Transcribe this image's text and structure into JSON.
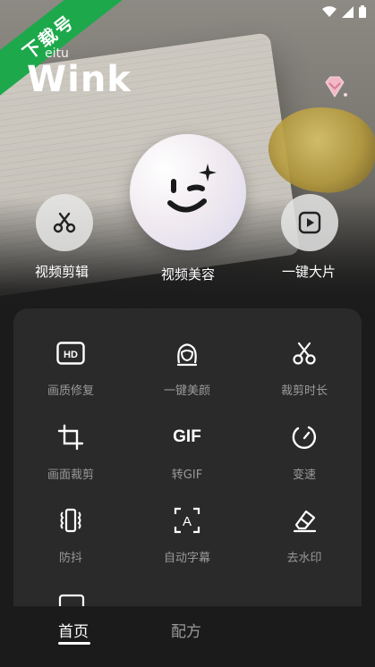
{
  "ribbon": {
    "text": "下载号"
  },
  "brand": {
    "small": "eitu",
    "name": "Wink"
  },
  "status_icons": [
    "wifi-icon",
    "signal-icon",
    "battery-icon"
  ],
  "premium": {
    "icon": "diamond-icon"
  },
  "features": [
    {
      "label": "视频剪辑",
      "icon": "scissors-icon"
    },
    {
      "label": "视频美容",
      "icon": "wink-face-icon"
    },
    {
      "label": "一键大片",
      "icon": "play-icon"
    }
  ],
  "tools": [
    {
      "label": "画质修复",
      "icon": "hd-icon"
    },
    {
      "label": "一键美颜",
      "icon": "face-beauty-icon"
    },
    {
      "label": "裁剪时长",
      "icon": "scissors-icon"
    },
    {
      "label": "画面裁剪",
      "icon": "crop-icon"
    },
    {
      "label": "转GIF",
      "icon": "gif-icon",
      "icon_text": "GIF"
    },
    {
      "label": "变速",
      "icon": "speedometer-icon"
    },
    {
      "label": "防抖",
      "icon": "stabilize-icon"
    },
    {
      "label": "自动字幕",
      "icon": "subtitle-icon",
      "icon_text": "A"
    },
    {
      "label": "去水印",
      "icon": "eraser-icon"
    }
  ],
  "bottom_nav": [
    {
      "label": "首页",
      "active": true
    },
    {
      "label": "配方",
      "active": false
    }
  ],
  "colors": {
    "ribbon": "#1da84b",
    "panel": "#2a2a2a",
    "label_muted": "#9a9a9a"
  }
}
